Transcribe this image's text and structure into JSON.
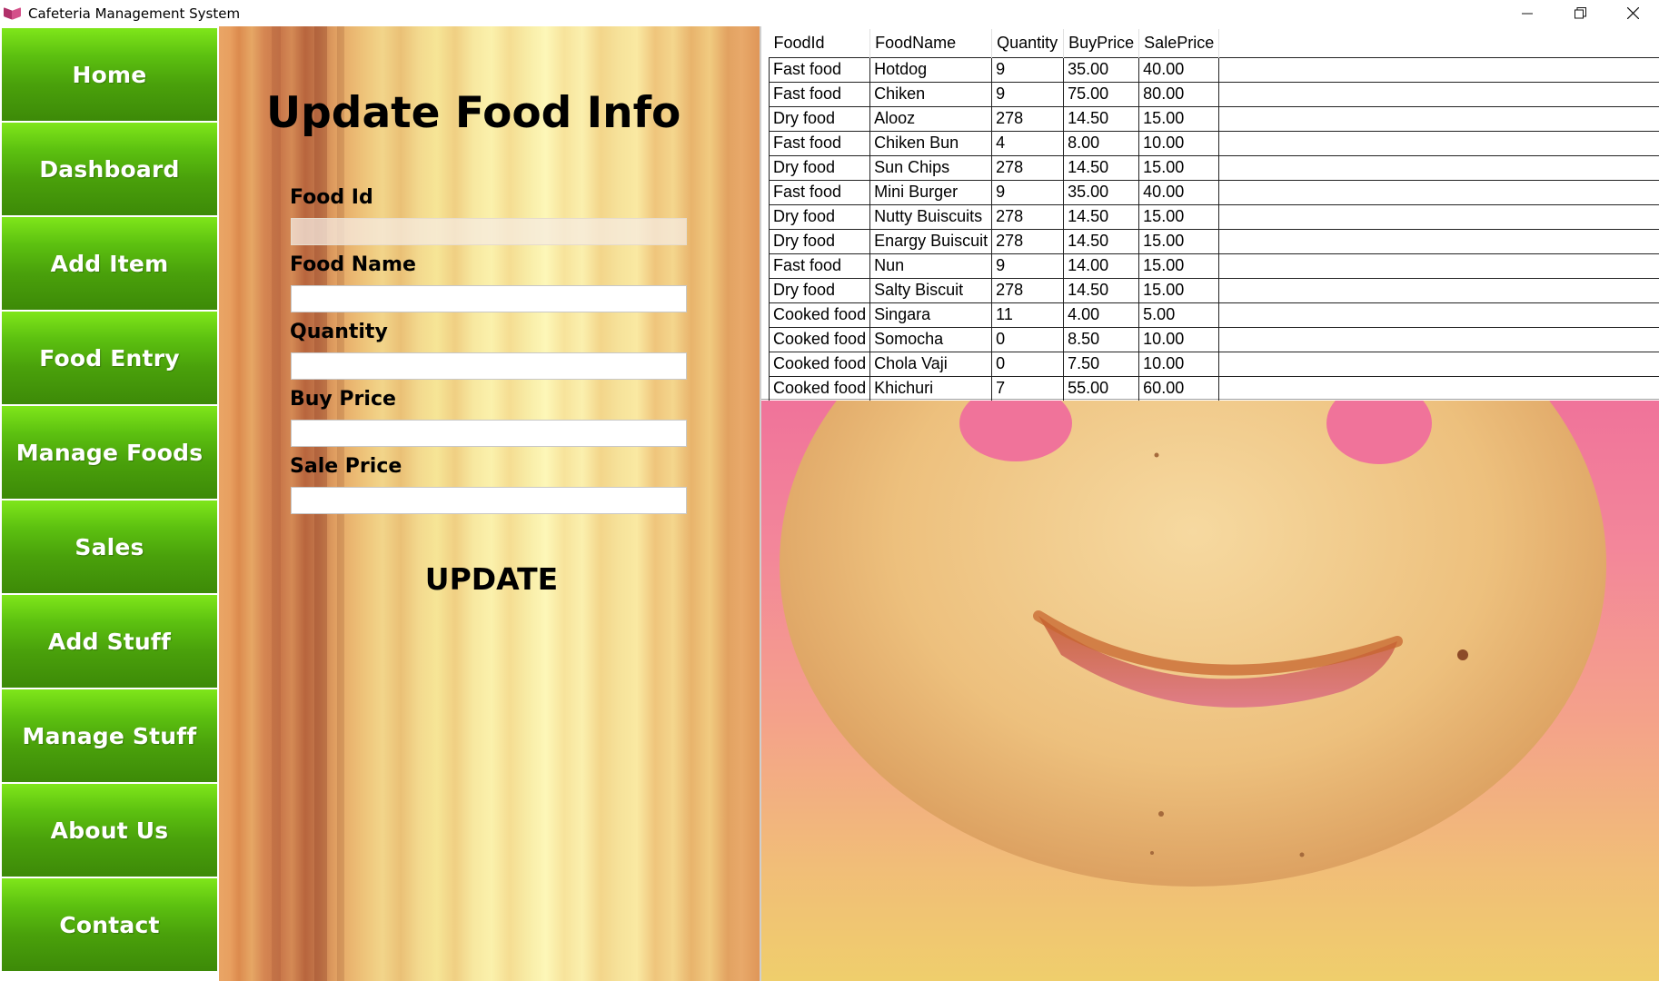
{
  "window": {
    "title": "Cafeteria Management System",
    "controls": {
      "minimize": "—",
      "restore": "❐",
      "close": "✕"
    }
  },
  "sidebar": {
    "items": [
      {
        "label": "Home"
      },
      {
        "label": "Dashboard"
      },
      {
        "label": "Add Item"
      },
      {
        "label": "Food Entry"
      },
      {
        "label": "Manage Foods"
      },
      {
        "label": "Sales"
      },
      {
        "label": "Add Stuff"
      },
      {
        "label": "Manage Stuff"
      },
      {
        "label": "About Us"
      },
      {
        "label": "Contact"
      }
    ]
  },
  "form": {
    "title": "Update Food Info",
    "fields": [
      {
        "label": "Food Id",
        "value": ""
      },
      {
        "label": "Food Name",
        "value": ""
      },
      {
        "label": "Quantity",
        "value": ""
      },
      {
        "label": "Buy Price",
        "value": ""
      },
      {
        "label": "Sale Price",
        "value": ""
      }
    ],
    "update_label": "UPDATE"
  },
  "grid": {
    "columns": [
      "FoodId",
      "FoodName",
      "Quantity",
      "BuyPrice",
      "SalePrice"
    ],
    "rows": [
      [
        "Fast food",
        "Hotdog",
        "9",
        "35.00",
        "40.00"
      ],
      [
        "Fast food",
        "Chiken",
        "9",
        "75.00",
        "80.00"
      ],
      [
        "Dry food",
        "Alooz",
        "278",
        "14.50",
        "15.00"
      ],
      [
        "Fast food",
        "Chiken Bun",
        "4",
        "8.00",
        "10.00"
      ],
      [
        "Dry food",
        "Sun Chips",
        "278",
        "14.50",
        "15.00"
      ],
      [
        "Fast food",
        "Mini Burger",
        "9",
        "35.00",
        "40.00"
      ],
      [
        "Dry food",
        "Nutty Buiscuits",
        "278",
        "14.50",
        "15.00"
      ],
      [
        "Dry food",
        "Enargy Buiscuit",
        "278",
        "14.50",
        "15.00"
      ],
      [
        "Fast food",
        "Nun",
        "9",
        "14.00",
        "15.00"
      ],
      [
        "Dry food",
        "Salty Biscuit",
        "278",
        "14.50",
        "15.00"
      ],
      [
        "Cooked food",
        "Singara",
        "11",
        "4.00",
        "5.00"
      ],
      [
        "Cooked food",
        "Somocha",
        "0",
        "8.50",
        "10.00"
      ],
      [
        "Cooked food",
        "Chola Vaji",
        "0",
        "7.50",
        "10.00"
      ],
      [
        "Cooked food",
        "Khichuri",
        "7",
        "55.00",
        "60.00"
      ]
    ]
  },
  "colors": {
    "nav_green": "#4aa10b",
    "nav_text": "#ffffff",
    "smiley_bg_top": "#f0739a",
    "smiley_bg_bottom": "#efce6c"
  },
  "icons": {
    "app": "book-icon",
    "minimize": "minimize-icon",
    "restore": "restore-icon",
    "close": "close-icon"
  }
}
